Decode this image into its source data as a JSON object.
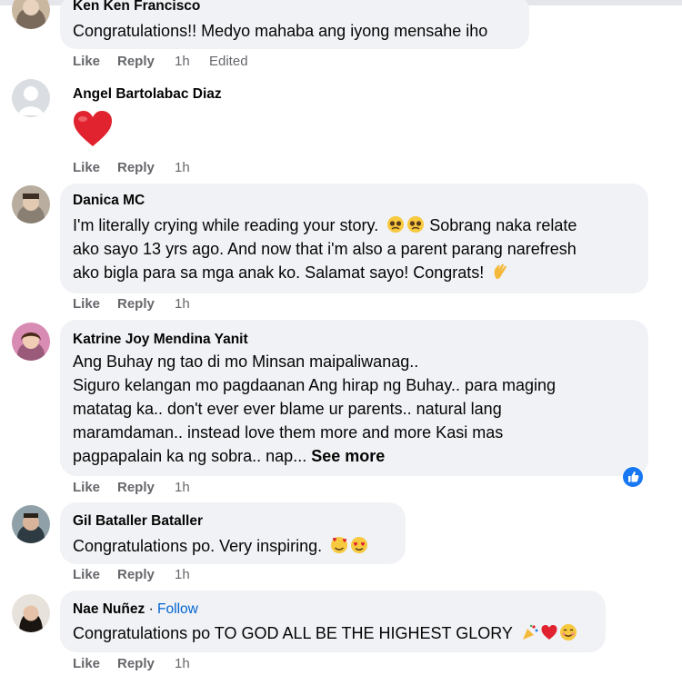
{
  "comments": [
    {
      "name": "Ken Ken Francisco",
      "lines": [
        "Congratulations!! Medyo mahaba ang iyong mensahe iho"
      ],
      "time": "1h",
      "edited": "Edited"
    },
    {
      "name": "Angel Bartolabac Diaz",
      "emoji": "red-heart",
      "time": "1h"
    },
    {
      "name": "Danica MC",
      "lines": [
        "I'm literally crying while reading your story.",
        "ako sayo 13 yrs ago. And now that i'm also a parent parang narefresh",
        "ako bigla para sa mga anak ko. Salamat sayo! Congrats!"
      ],
      "line1_tail": "Sobrang naka relate",
      "time": "1h"
    },
    {
      "name": "Katrine Joy Mendina Yanit",
      "lines": [
        "Ang Buhay ng tao di mo Minsan maipaliwanag..",
        "Siguro kelangan mo pagdaanan Ang hirap ng Buhay.. para maging",
        "matatag ka.. don't ever ever blame ur parents.. natural lang",
        "maramdaman.. instead love them more and more Kasi mas",
        "pagpapalain ka ng sobra.. nap..."
      ],
      "see_more": "See more",
      "time": "1h"
    },
    {
      "name": "Gil Bataller Bataller",
      "lines": [
        "Congratulations po. Very inspiring."
      ],
      "time": "1h"
    },
    {
      "name": "Nae Nuñez",
      "follow": "Follow",
      "dot": "·",
      "lines": [
        "Congratulations po TO GOD ALL BE THE HIGHEST GLORY"
      ],
      "time": "1h"
    }
  ],
  "actions": {
    "like": "Like",
    "reply": "Reply"
  },
  "colors": {
    "bubble": "#f0f2f5",
    "meta": "#65676b",
    "link": "#0064d1",
    "like_blue": "#1877f2"
  }
}
